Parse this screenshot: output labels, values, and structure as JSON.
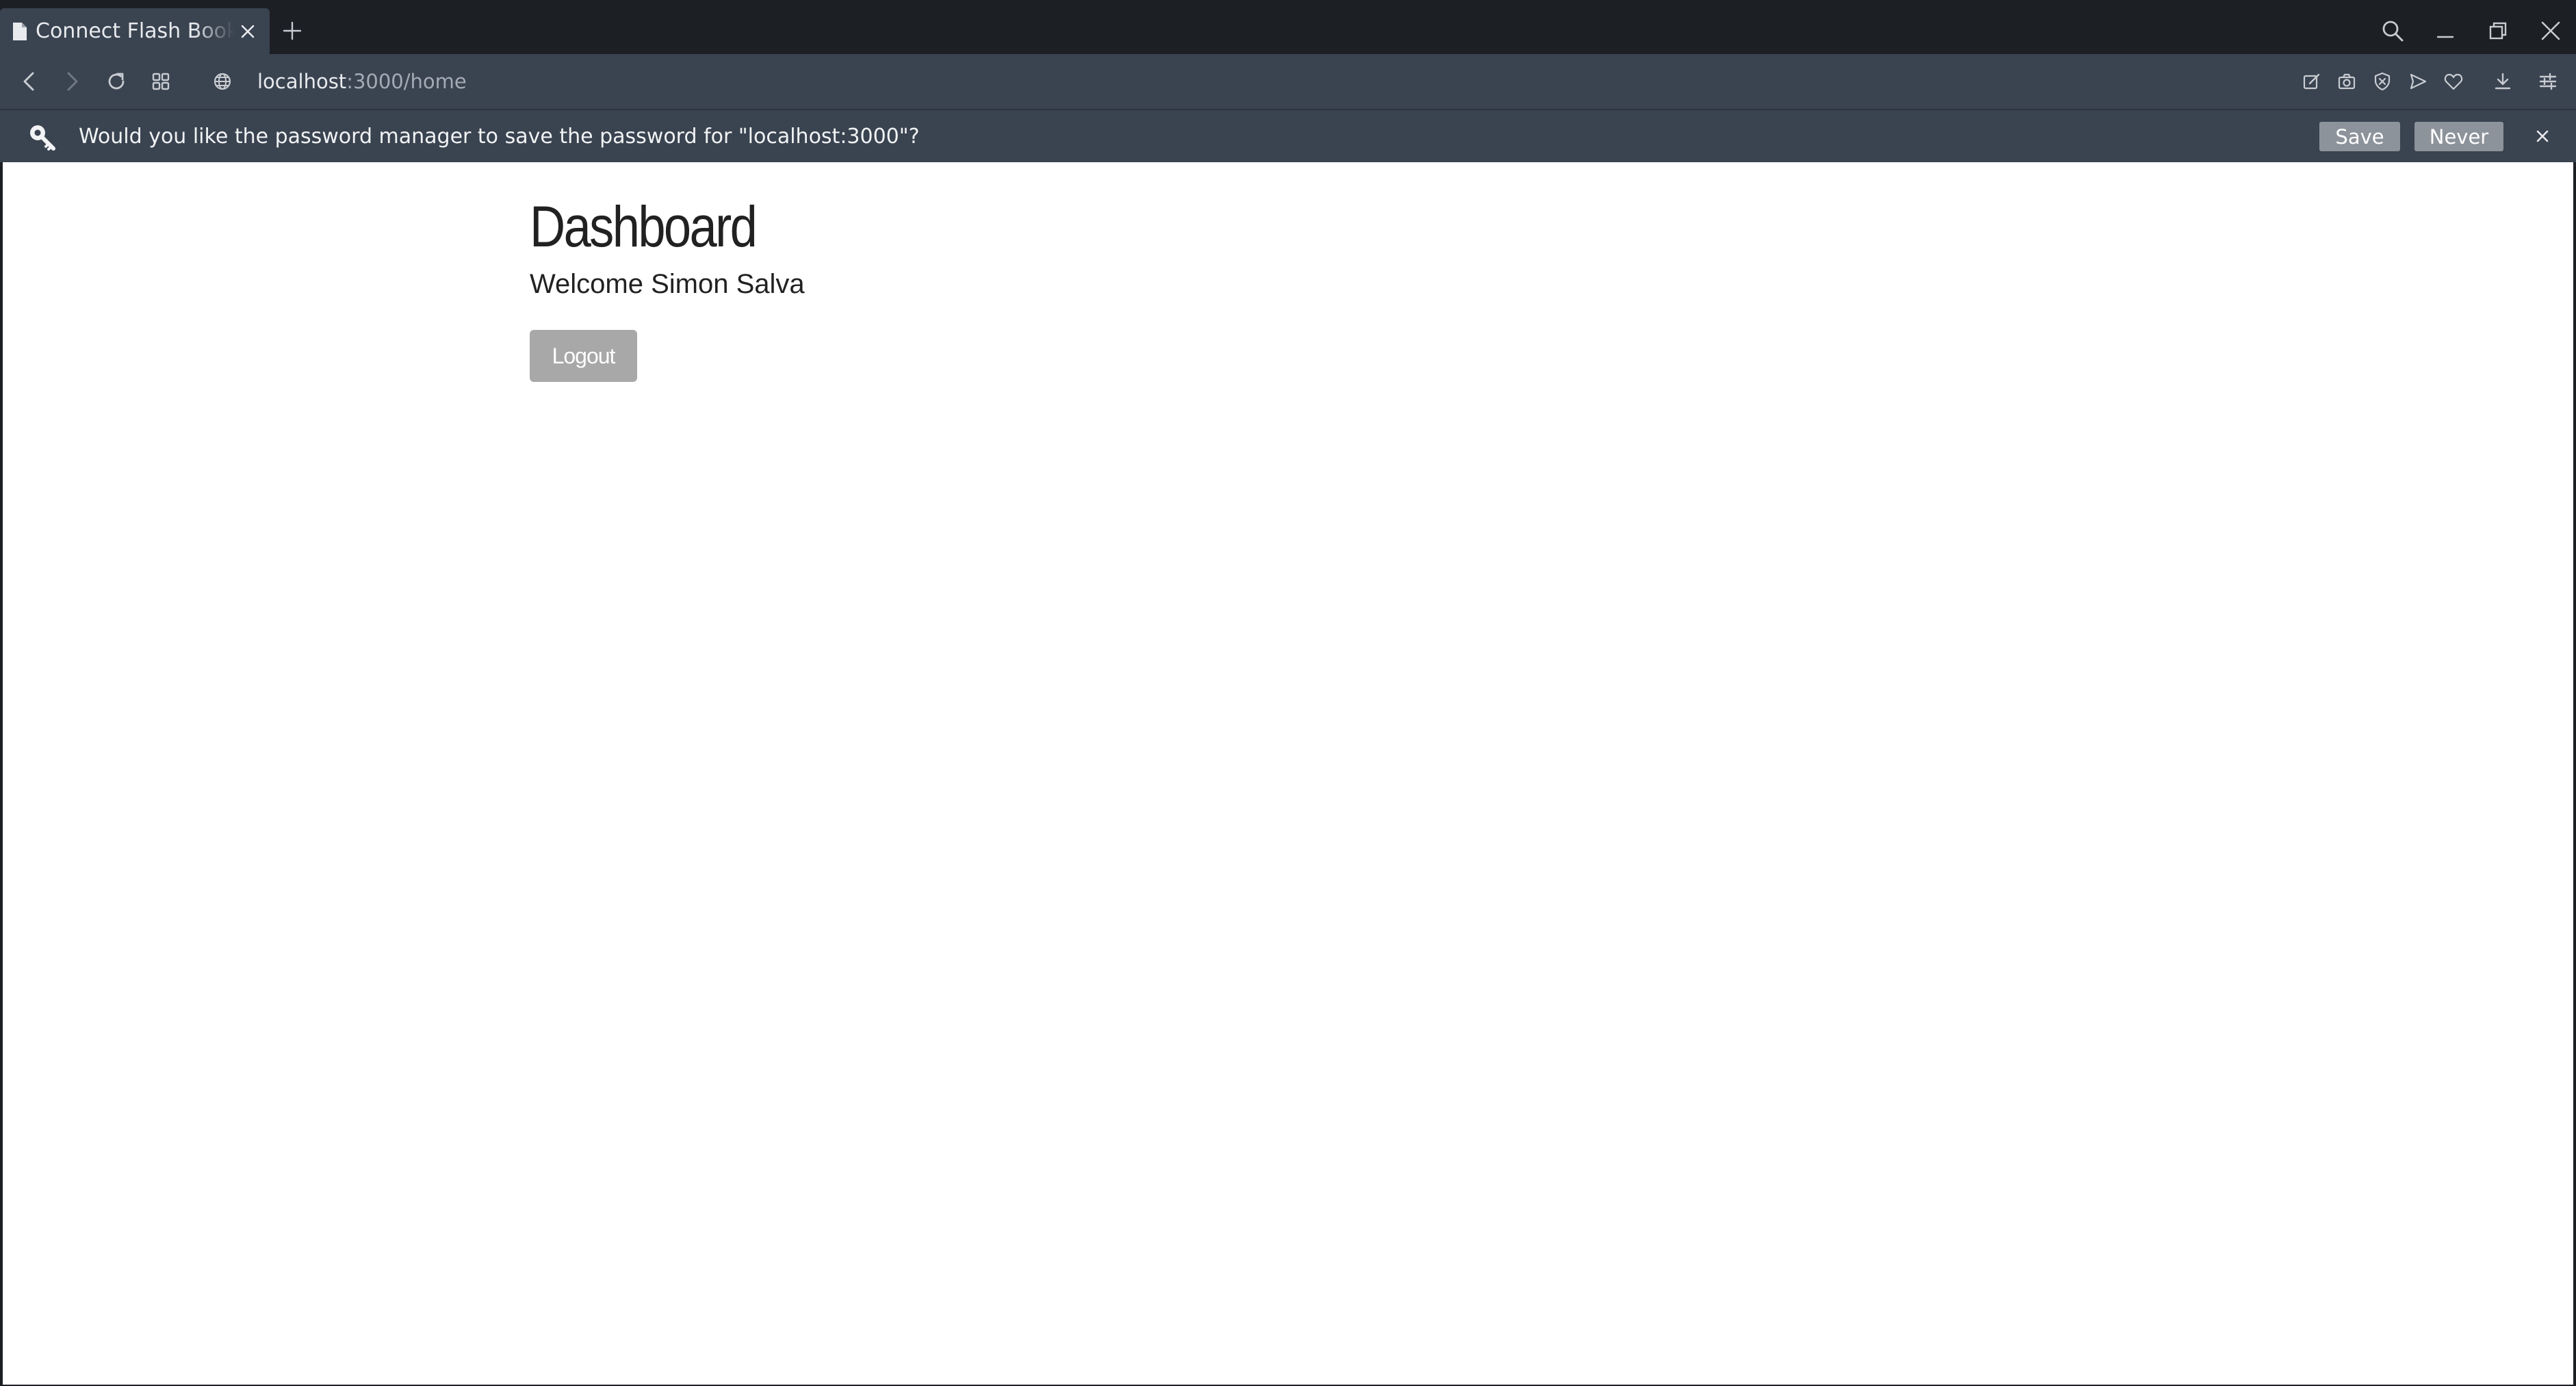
{
  "browser": {
    "tab": {
      "title": "Connect Flash Book",
      "favicon": "document-icon"
    },
    "url": {
      "host": "localhost",
      "path": ":3000/home"
    },
    "colors": {
      "chrome_dark": "#1c1f24",
      "chrome": "#3a4350",
      "text": "#e8eaed"
    }
  },
  "infobar": {
    "icon": "key-search-icon",
    "message": "Would you like the password manager to save the password for \"localhost:3000\"?",
    "save_label": "Save",
    "never_label": "Never",
    "close_glyph": "×"
  },
  "page": {
    "title": "Dashboard",
    "welcome": "Welcome Simon Salva",
    "logout_label": "Logout",
    "colors": {
      "background": "#ffffff",
      "text": "#212121",
      "button": "#a8a8a8"
    }
  }
}
